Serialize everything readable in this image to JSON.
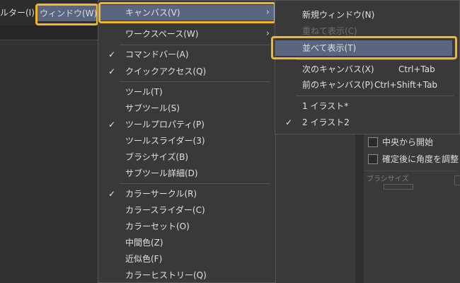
{
  "menubar": {
    "filter_label": "ルター(I)",
    "window_label": "ウィンドウ(W)"
  },
  "window_menu": {
    "items": [
      {
        "label": "キャンバス(V)",
        "arrow": "›"
      },
      {
        "label": "ワークスペース(W)",
        "arrow": "›"
      },
      {
        "label": "コマンドバー(A)",
        "check": "✓"
      },
      {
        "label": "クイックアクセス(Q)",
        "check": "✓"
      },
      {
        "label": "ツール(T)"
      },
      {
        "label": "サブツール(S)"
      },
      {
        "label": "ツールプロパティ(P)",
        "check": "✓"
      },
      {
        "label": "ツールスライダー(3)"
      },
      {
        "label": "ブラシサイズ(B)"
      },
      {
        "label": "サブツール詳細(D)"
      },
      {
        "label": "カラーサークル(R)",
        "check": "✓"
      },
      {
        "label": "カラースライダー(C)"
      },
      {
        "label": "カラーセット(O)"
      },
      {
        "label": "中間色(Z)"
      },
      {
        "label": "近似色(F)"
      },
      {
        "label": "カラーヒストリー(Q)"
      }
    ]
  },
  "canvas_menu": {
    "items": [
      {
        "label": "新規ウィンドウ(N)"
      },
      {
        "label": "重ねて表示(C)"
      },
      {
        "label": "並べて表示(T)"
      },
      {
        "label": "次のキャンバス(X)",
        "shortcut": "Ctrl+Tab"
      },
      {
        "label": "前のキャンバス(P)",
        "shortcut": "Ctrl+Shift+Tab"
      },
      {
        "label": "1 イラスト*"
      },
      {
        "label": "2 イラスト2",
        "check": "✓"
      }
    ]
  },
  "tool_panel": {
    "start_center": "中央から開始",
    "adjust_angle": "確定後に角度を調整",
    "brush_size": "ブラシサイズ"
  },
  "colors": {
    "highlight_frame": "#f5b52a",
    "active_item": "#5a6680",
    "menu_bg": "#393939"
  }
}
